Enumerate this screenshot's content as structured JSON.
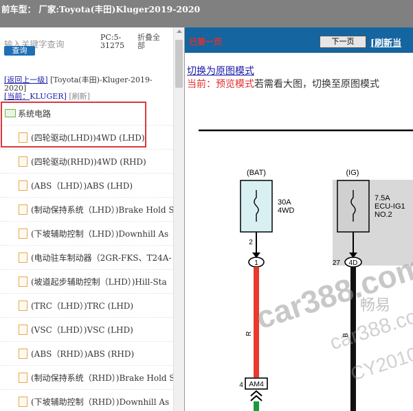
{
  "header": {
    "title": "前车型： 厂家:Toyota(丰田)Kluger2019-2020"
  },
  "left": {
    "search_placeholder": "输入关键字查询",
    "search_button": "查询",
    "pc_info": "PC:5-31275",
    "collapse_all": "折叠全部",
    "nav_back": "[返回上一级]",
    "nav_path": " [Toyota(丰田)-Kluger-2019-2020]",
    "nav_current_label": "[当前：",
    "nav_current_value": "KLUGER]",
    "nav_refresh": "[刷新]"
  },
  "tree": [
    {
      "label": "系统电路",
      "type": "folder"
    },
    {
      "label": "(四轮驱动(LHD))4WD (LHD)",
      "type": "file"
    },
    {
      "label": "(四轮驱动(RHD))4WD (RHD)",
      "type": "file"
    },
    {
      "label": "(ABS（LHD）)ABS (LHD)",
      "type": "file"
    },
    {
      "label": "(制动保持系统（LHD）)Brake Hold S",
      "type": "file"
    },
    {
      "label": "(下坡辅助控制（LHD）)Downhill As",
      "type": "file"
    },
    {
      "label": "(电动驻车制动器（2GR-FKS、T24A-",
      "type": "file"
    },
    {
      "label": "(坡道起步辅助控制（LHD）)Hill-Sta",
      "type": "file"
    },
    {
      "label": "(TRC（LHD）)TRC (LHD)",
      "type": "file"
    },
    {
      "label": "(VSC（LHD）)VSC (LHD)",
      "type": "file"
    },
    {
      "label": "(ABS（RHD）)ABS (RHD)",
      "type": "file"
    },
    {
      "label": "(制动保持系统（RHD）)Brake Hold S",
      "type": "file"
    },
    {
      "label": "(下坡辅助控制（RHD）)Downhill As",
      "type": "file"
    }
  ],
  "right": {
    "first_page": "已第一页",
    "next_page": "下一页",
    "refresh": "[刷新当",
    "switch_original": "切换为原图模式",
    "current_prefix": "当前：预览模式",
    "current_suffix": "若需看大图，切换至原图模式"
  },
  "diagram": {
    "bat_label": "(BAT)",
    "bat_fuse": "30A",
    "bat_fuse2": "4WD",
    "bat_pin_top": "2",
    "bat_pin": "1",
    "ig_label": "(IG)",
    "ig_fuse": "7.5A",
    "ig_fuse2": "ECU-IG1",
    "ig_fuse3": "NO.2",
    "ig_pin": "27",
    "ig_pin2": "4D",
    "wire_r": "R",
    "wire_b": "B",
    "conn_num": "4",
    "conn_name": "AM4",
    "wm1": "car388.com",
    "wm2": "畅易",
    "wm3": "car388.com",
    "wm4": "CY2010"
  },
  "colors": {
    "topbar": "#808080",
    "rightbar": "#1565a0",
    "highlight": "#d9383a"
  }
}
